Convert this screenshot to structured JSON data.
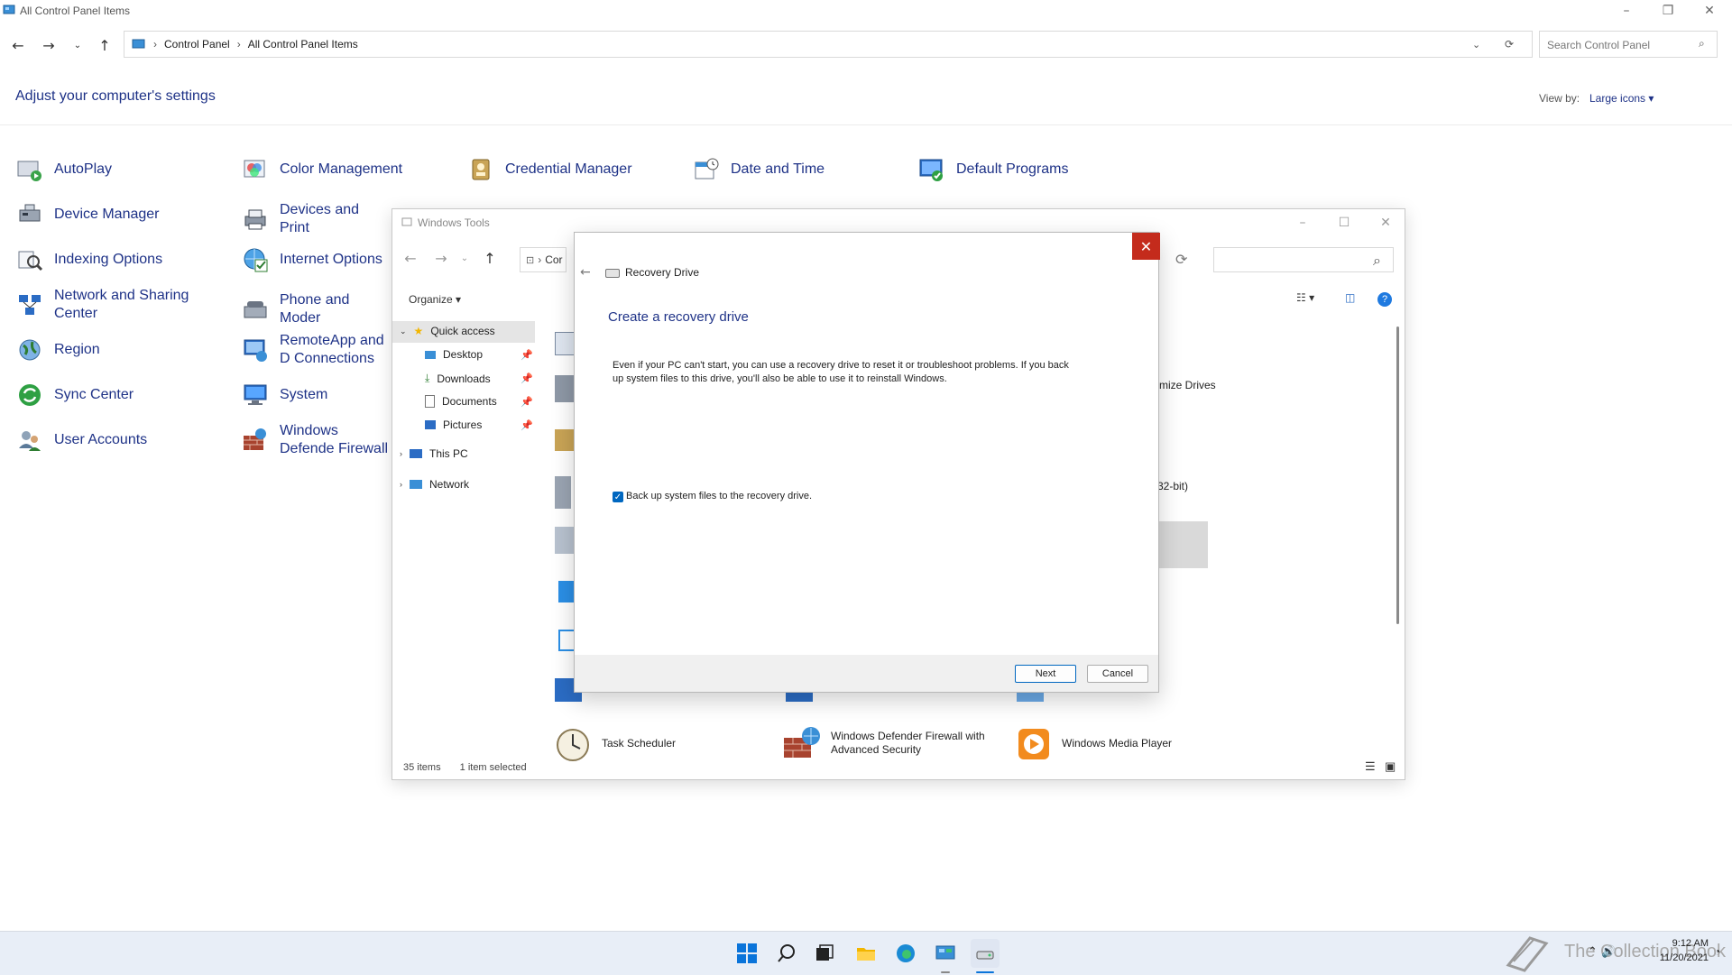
{
  "cp": {
    "window_title": "All Control Panel Items",
    "breadcrumb": [
      "Control Panel",
      "All Control Panel Items"
    ],
    "search_placeholder": "Search Control Panel",
    "heading": "Adjust your computer's settings",
    "view_by_label": "View by:",
    "view_by_value": "Large icons",
    "items": [
      {
        "label": "AutoPlay",
        "icon": "autoplay-icon"
      },
      {
        "label": "Color Management",
        "icon": "color-management-icon"
      },
      {
        "label": "Credential Manager",
        "icon": "credential-manager-icon"
      },
      {
        "label": "Date and Time",
        "icon": "date-time-icon"
      },
      {
        "label": "Default Programs",
        "icon": "default-programs-icon"
      },
      {
        "label": "Device Manager",
        "icon": "device-manager-icon"
      },
      {
        "label": "Devices and Print",
        "icon": "devices-printers-icon"
      },
      {
        "label": "Indexing Options",
        "icon": "indexing-options-icon"
      },
      {
        "label": "Internet Options",
        "icon": "internet-options-icon"
      },
      {
        "label": "Network and Sharing Center",
        "icon": "network-sharing-icon"
      },
      {
        "label": "Phone and Moder",
        "icon": "phone-modem-icon"
      },
      {
        "label": "Region",
        "icon": "region-icon"
      },
      {
        "label": "RemoteApp and D Connections",
        "icon": "remoteapp-icon"
      },
      {
        "label": "Sync Center",
        "icon": "sync-center-icon"
      },
      {
        "label": "System",
        "icon": "system-icon"
      },
      {
        "label": "User Accounts",
        "icon": "user-accounts-icon"
      },
      {
        "label": "Windows Defende Firewall",
        "icon": "firewall-icon"
      }
    ]
  },
  "wt": {
    "window_title": "Windows Tools",
    "address_text": "Cor",
    "organize_label": "Organize",
    "sidebar": {
      "quick_access": "Quick access",
      "desktop": "Desktop",
      "downloads": "Downloads",
      "documents": "Documents",
      "pictures": "Pictures",
      "this_pc": "This PC",
      "network": "Network"
    },
    "files": {
      "optimize_drives": "mize Drives",
      "bit32": "32-bit)",
      "task_scheduler": "Task Scheduler",
      "firewall_advanced": "Windows Defender Firewall with Advanced Security",
      "media_player": "Windows Media Player"
    },
    "status_items": "35 items",
    "status_selected": "1 item selected"
  },
  "dialog": {
    "app_name": "Recovery Drive",
    "heading": "Create a recovery drive",
    "body": "Even if your PC can't start, you can use a recovery drive to reset it or troubleshoot problems. If you back up system files to this drive, you'll also be able to use it to reinstall Windows.",
    "checkbox_label": "Back up system files to the recovery drive.",
    "checkbox_checked": true,
    "next_label": "Next",
    "cancel_label": "Cancel"
  },
  "taskbar": {
    "time": "9:12 AM",
    "date": "11/20/2021",
    "watermark": "The Collection Book"
  },
  "colors": {
    "link_blue": "#1e3287",
    "close_red": "#c42b1c",
    "accent": "#0067c0"
  }
}
